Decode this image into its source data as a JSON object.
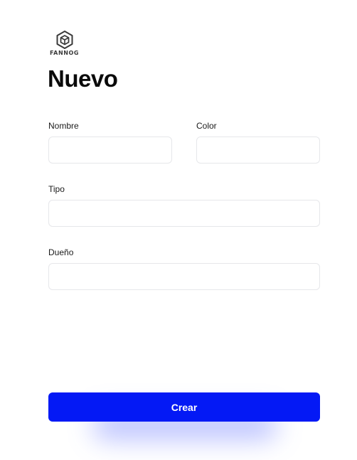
{
  "brand": {
    "name": "FANNOG",
    "icon": "cube-logo-icon"
  },
  "page": {
    "title": "Nuevo"
  },
  "form": {
    "nombre": {
      "label": "Nombre",
      "value": "",
      "placeholder": ""
    },
    "color": {
      "label": "Color",
      "value": "",
      "placeholder": ""
    },
    "tipo": {
      "label": "Tipo",
      "value": "",
      "placeholder": ""
    },
    "dueno": {
      "label": "Dueño",
      "value": "",
      "placeholder": ""
    },
    "submit_label": "Crear"
  },
  "colors": {
    "primary": "#0419f5",
    "input_border": "#e6e7ea",
    "text": "#111111"
  }
}
